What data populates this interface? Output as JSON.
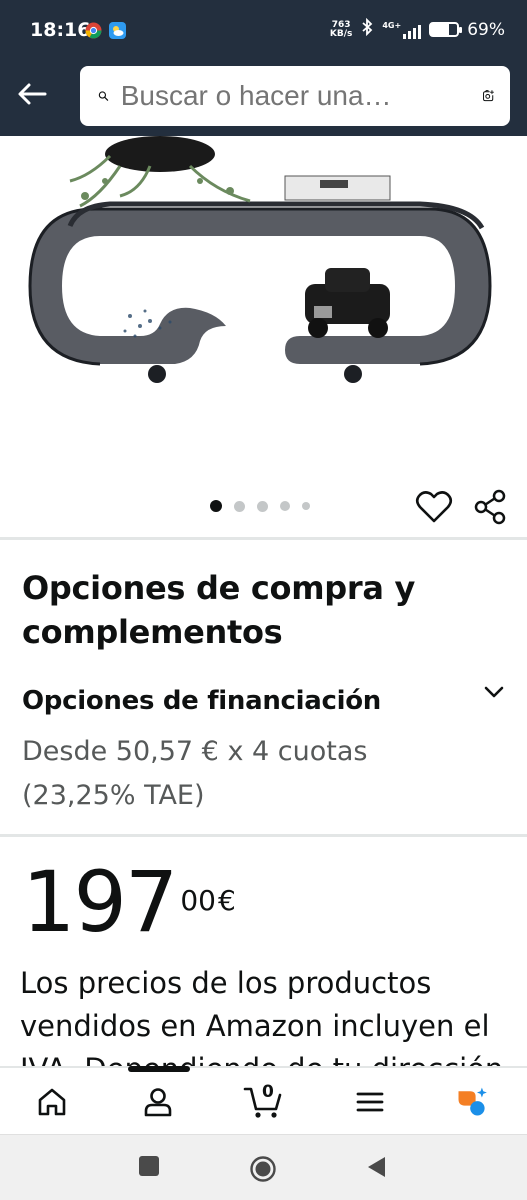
{
  "status_bar": {
    "time": "18:16",
    "net_speed_value": "763",
    "net_speed_unit": "KB/s",
    "network": "4G+",
    "battery_text": "69%",
    "battery_level": 0.69
  },
  "header": {
    "search_placeholder": "Buscar o hacer una…"
  },
  "product_gallery": {
    "image_count": 5,
    "active_index": 0
  },
  "purchase_options": {
    "title": "Opciones de compra y complementos",
    "financing_title": "Opciones de financiación",
    "financing_line1": "Desde 50,57 € x 4 cuotas",
    "financing_line2": "(23,25% TAE)"
  },
  "price": {
    "whole": "197",
    "fraction": "00",
    "symbol": "€",
    "note": "Los precios de los productos vendidos en Amazon incluyen el IVA. Dependiendo de tu dirección"
  },
  "bottom_nav": {
    "cart_count": "0",
    "active_item": "account"
  },
  "colors": {
    "header_bg": "#232f3e",
    "text": "#0f1111",
    "muted": "#565959",
    "rufus_orange": "#f47f24",
    "rufus_blue": "#1b8fe8"
  }
}
